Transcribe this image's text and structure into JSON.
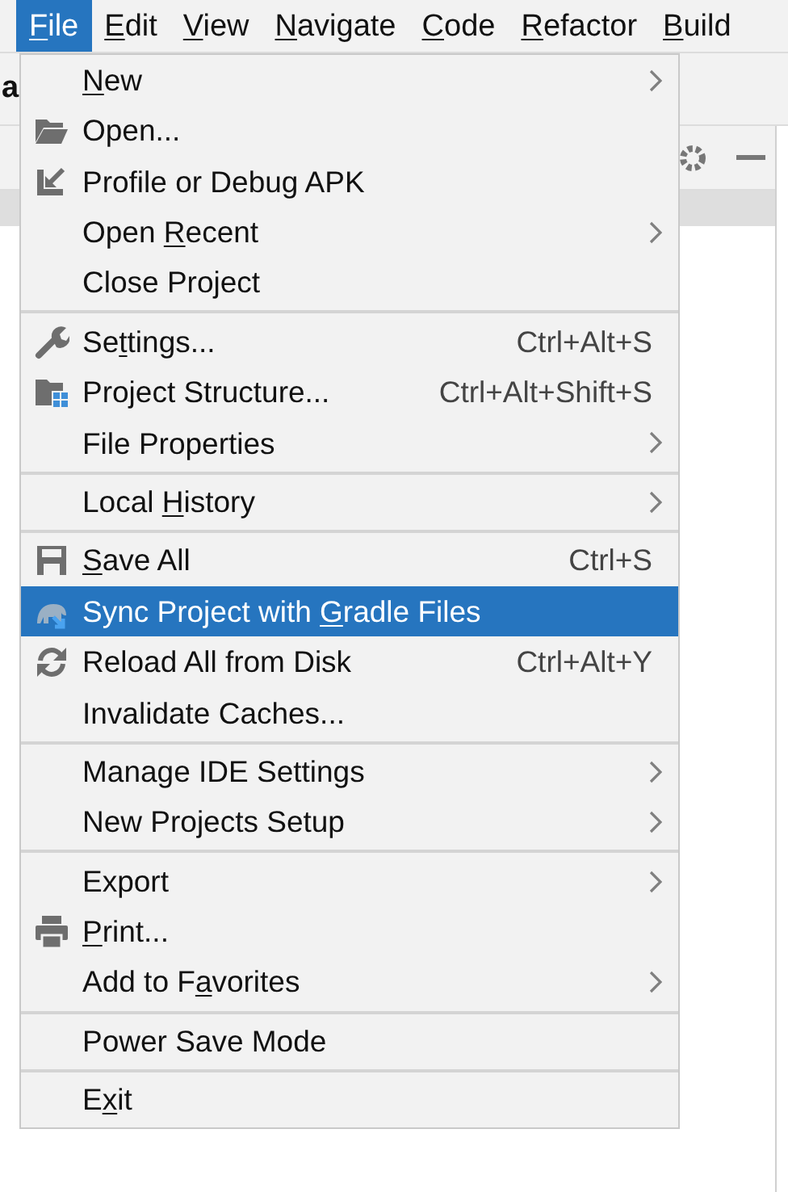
{
  "menu_bar": [
    {
      "label": {
        "key": "F",
        "post": "ile"
      },
      "selected": true
    },
    {
      "label": {
        "key": "E",
        "post": "dit"
      },
      "selected": false
    },
    {
      "label": {
        "key": "V",
        "post": "iew"
      },
      "selected": false
    },
    {
      "label": {
        "key": "N",
        "post": "avigate"
      },
      "selected": false
    },
    {
      "label": {
        "key": "C",
        "post": "ode"
      },
      "selected": false
    },
    {
      "label": {
        "key": "R",
        "post": "efactor"
      },
      "selected": false
    },
    {
      "label": {
        "key": "B",
        "post": "uild"
      },
      "selected": false
    }
  ],
  "background": {
    "partial_title": "a"
  },
  "file_menu": [
    {
      "kind": "item",
      "label": {
        "key": "N",
        "post": "ew"
      },
      "submenu": true,
      "selected": false
    },
    {
      "kind": "item",
      "label": {
        "pre": "Open..."
      },
      "submenu": false,
      "selected": false
    },
    {
      "kind": "item",
      "label": {
        "pre": "Profile or Debug APK"
      },
      "submenu": false,
      "selected": false
    },
    {
      "kind": "item",
      "label": {
        "pre": "Open ",
        "key": "R",
        "post": "ecent"
      },
      "submenu": true,
      "selected": false
    },
    {
      "kind": "item",
      "label": {
        "pre": "Close Project"
      },
      "submenu": false,
      "selected": false
    },
    {
      "kind": "separator"
    },
    {
      "kind": "item",
      "label": {
        "pre": "Se",
        "key": "t",
        "post": "tings..."
      },
      "shortcut": "Ctrl+Alt+S",
      "submenu": false,
      "selected": false
    },
    {
      "kind": "item",
      "label": {
        "pre": "Project Structure..."
      },
      "shortcut": "Ctrl+Alt+Shift+S",
      "submenu": false,
      "selected": false
    },
    {
      "kind": "item",
      "label": {
        "pre": "File Properties"
      },
      "submenu": true,
      "selected": false
    },
    {
      "kind": "separator"
    },
    {
      "kind": "item",
      "label": {
        "pre": "Local ",
        "key": "H",
        "post": "istory"
      },
      "submenu": true,
      "selected": false
    },
    {
      "kind": "separator"
    },
    {
      "kind": "item",
      "label": {
        "key": "S",
        "post": "ave All"
      },
      "shortcut": "Ctrl+S",
      "submenu": false,
      "selected": false
    },
    {
      "kind": "item",
      "label": {
        "pre": "Sync Project with ",
        "key": "G",
        "post": "radle Files"
      },
      "submenu": false,
      "selected": true
    },
    {
      "kind": "item",
      "label": {
        "pre": "Reload All from Disk"
      },
      "shortcut": "Ctrl+Alt+Y",
      "submenu": false,
      "selected": false
    },
    {
      "kind": "item",
      "label": {
        "pre": "Invalidate Caches..."
      },
      "submenu": false,
      "selected": false
    },
    {
      "kind": "separator"
    },
    {
      "kind": "item",
      "label": {
        "pre": "Manage IDE Settings"
      },
      "submenu": true,
      "selected": false
    },
    {
      "kind": "item",
      "label": {
        "pre": "New Projects Setup"
      },
      "submenu": true,
      "selected": false
    },
    {
      "kind": "separator"
    },
    {
      "kind": "item",
      "label": {
        "pre": "Export"
      },
      "submenu": true,
      "selected": false
    },
    {
      "kind": "item",
      "label": {
        "key": "P",
        "post": "rint..."
      },
      "submenu": false,
      "selected": false
    },
    {
      "kind": "item",
      "label": {
        "pre": "Add to F",
        "key": "a",
        "post": "vorites"
      },
      "submenu": true,
      "selected": false
    },
    {
      "kind": "separator"
    },
    {
      "kind": "item",
      "label": {
        "pre": "Power Save Mode"
      },
      "submenu": false,
      "selected": false
    },
    {
      "kind": "separator"
    },
    {
      "kind": "item",
      "label": {
        "pre": "E",
        "key": "x",
        "post": "it"
      },
      "submenu": false,
      "selected": false
    }
  ]
}
